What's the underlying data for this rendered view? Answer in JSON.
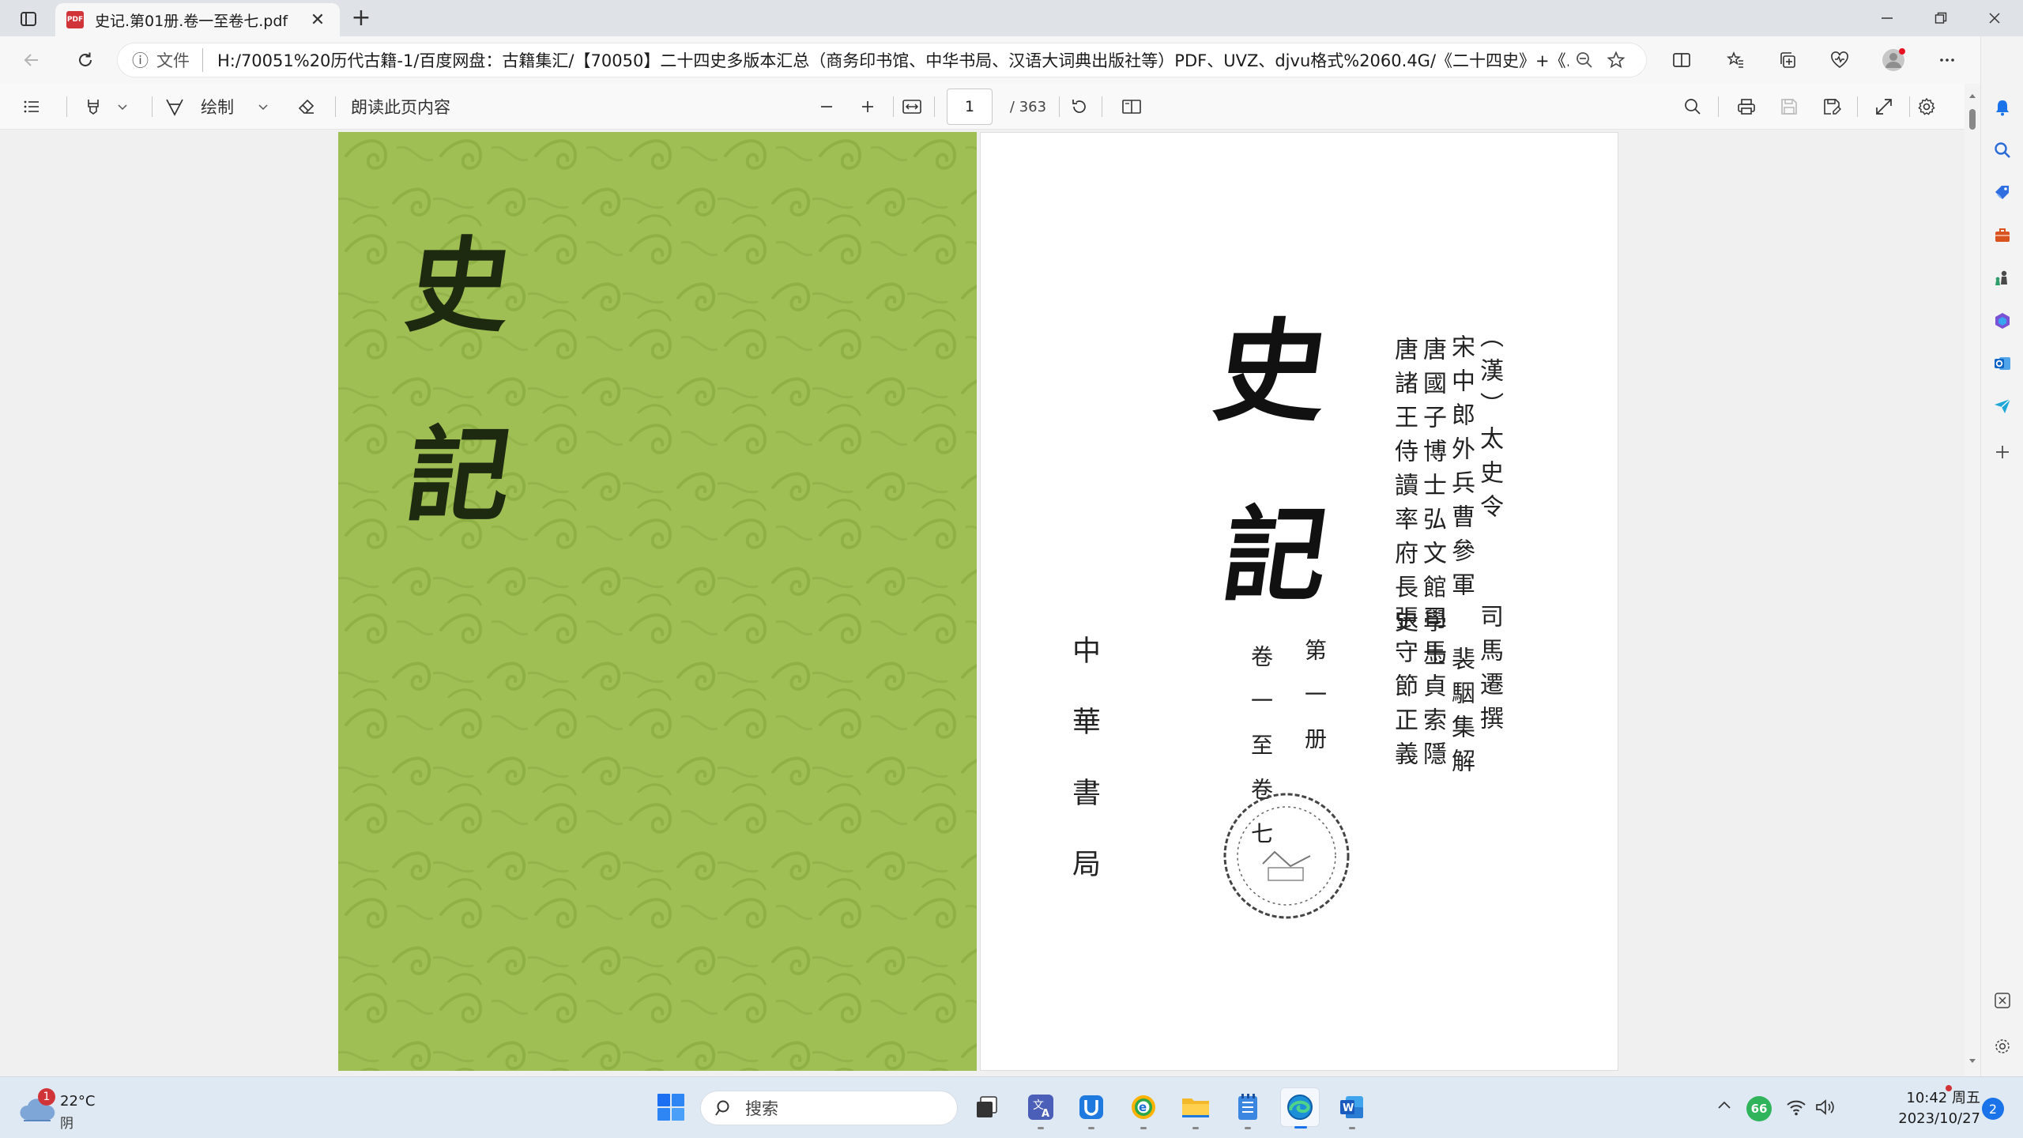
{
  "browser": {
    "tab_title": "史记.第01册.卷一至卷七.pdf",
    "tab_file_badge": "PDF",
    "address_scheme": "文件",
    "address_url": "H:/70051%20历代古籍-1/百度网盘：古籍集汇/【70050】二十四史多版本汇总（商务印书馆、中华书局、汉语大词典出版社等）PDF、UVZ、djvu格式%2060.4G/《二十四史》+《..."
  },
  "pdf_toolbar": {
    "draw_label": "绘制",
    "read_aloud_label": "朗读此页内容",
    "current_page": "1",
    "total_pages": "/ 363"
  },
  "left_page": {
    "title_chars": [
      "史",
      "記"
    ],
    "background_color": "#9fbf55"
  },
  "right_page": {
    "title_chars": [
      "史",
      "記"
    ],
    "author_cols": [
      "（漢）太史令",
      "宋中郎外兵曹參軍",
      "唐國子博士弘文館學士",
      "唐諸王侍讀率府長史"
    ],
    "author_names": [
      "司馬遷撰",
      "裴駰集解",
      "司馬貞索隱",
      "張守節正義"
    ],
    "volume_col_1": "第一册",
    "volume_col_2": "卷一至卷七",
    "publisher": "中華書局"
  },
  "taskbar": {
    "weather_temp": "22°C",
    "weather_desc": "阴",
    "weather_badge": "1",
    "search_placeholder": "搜索",
    "clock_time": "10:42 周五",
    "clock_date": "2023/10/27",
    "notif_count": "2",
    "security_badge": "66"
  }
}
